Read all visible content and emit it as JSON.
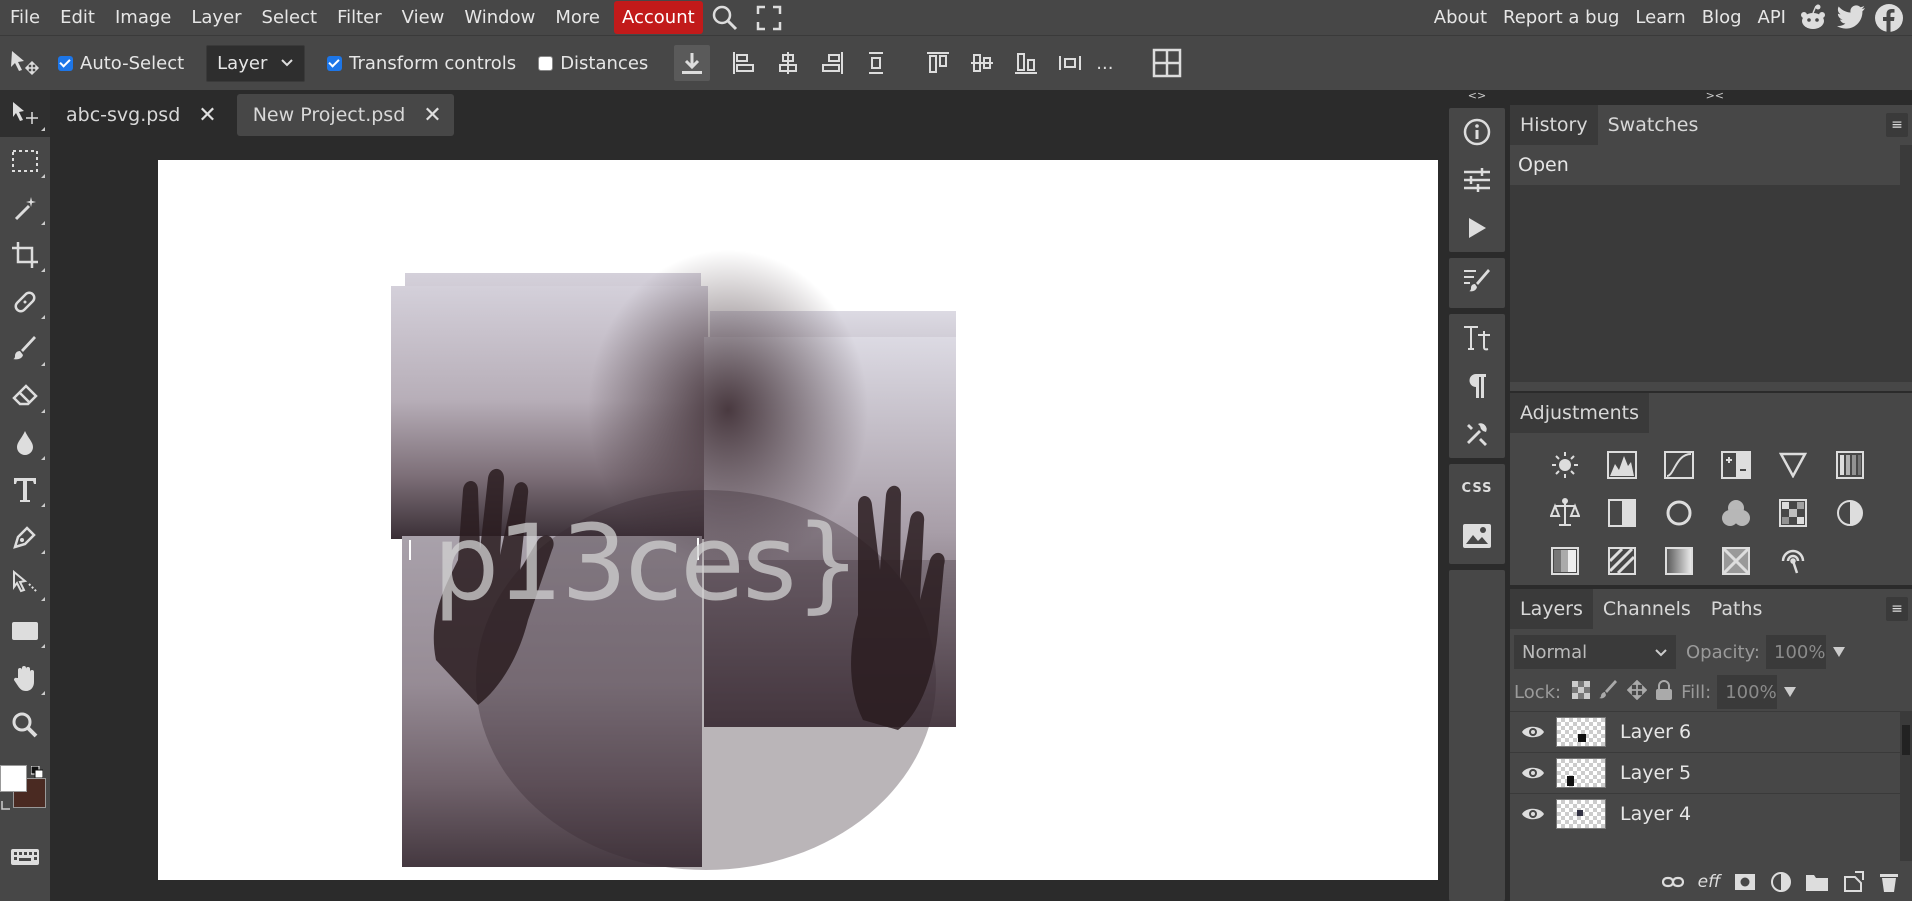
{
  "menu": {
    "items": [
      "File",
      "Edit",
      "Image",
      "Layer",
      "Select",
      "Filter",
      "View",
      "Window",
      "More"
    ],
    "account": "Account",
    "right_links": [
      "About",
      "Report a bug",
      "Learn",
      "Blog",
      "API"
    ],
    "social_icons": [
      "reddit-icon",
      "twitter-icon",
      "facebook-icon"
    ]
  },
  "options": {
    "auto_select_label": "Auto-Select",
    "auto_select_checked": true,
    "layer_select": "Layer",
    "transform_label": "Transform controls",
    "transform_checked": true,
    "distances_label": "Distances",
    "distances_checked": false,
    "more": "..."
  },
  "tabs": [
    {
      "title": "abc-svg.psd",
      "active": false
    },
    {
      "title": "New Project.psd",
      "active": true
    }
  ],
  "canvas": {
    "text_layer": "p13ces}"
  },
  "colors": {
    "foreground": "#ffffff",
    "background": "#4a2a22",
    "account_red": "#c21a1a",
    "checkbox_blue": "#1d76e8"
  },
  "panels": {
    "collapse_arrows_left": "<>",
    "collapse_arrows_right": "><",
    "history_tabs": [
      "History",
      "Swatches"
    ],
    "history_items": [
      "Open"
    ],
    "adjustments_title": "Adjustments",
    "layers_tabs": [
      "Layers",
      "Channels",
      "Paths"
    ],
    "blend_mode": "Normal",
    "opacity_label": "Opacity:",
    "opacity_value": "100%",
    "lock_label": "Lock:",
    "fill_label": "Fill:",
    "fill_value": "100%",
    "layers": [
      "Layer 6",
      "Layer 5",
      "Layer 4"
    ],
    "css_label": "CSS",
    "footer_eff": "eff"
  }
}
